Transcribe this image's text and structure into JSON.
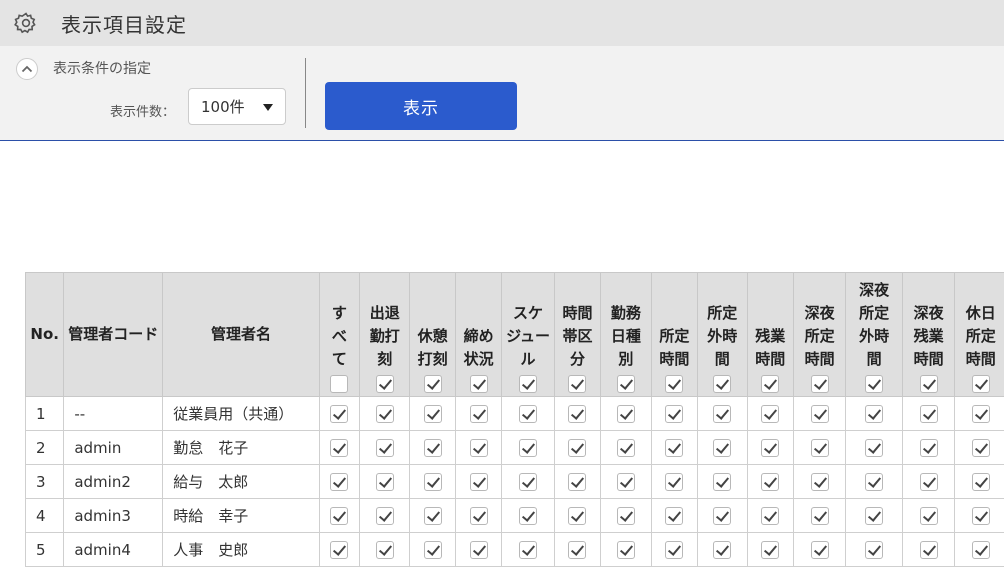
{
  "header": {
    "title": "表示項目設定",
    "icon": "gear-icon"
  },
  "conditions": {
    "title": "表示条件の指定",
    "count_label": "表示件数：",
    "count_value": "100件",
    "show_button": "表示"
  },
  "table": {
    "columns": [
      {
        "label": "No.",
        "type": "text"
      },
      {
        "label": "管理者コード",
        "type": "text"
      },
      {
        "label": "管理者名",
        "type": "text"
      },
      {
        "label": "すべて",
        "lines": [
          "す",
          "べ",
          "て"
        ],
        "checked": false
      },
      {
        "label": "出退勤打刻",
        "lines": [
          "出退",
          "勤打",
          "刻"
        ],
        "checked": true
      },
      {
        "label": "休憩打刻",
        "lines": [
          "休憩",
          "打刻"
        ],
        "checked": true
      },
      {
        "label": "締め状況",
        "lines": [
          "締め",
          "状況"
        ],
        "checked": true
      },
      {
        "label": "スケジュール",
        "lines": [
          "スケ",
          "ジュー",
          "ル"
        ],
        "checked": true
      },
      {
        "label": "時間帯区分",
        "lines": [
          "時間",
          "帯区",
          "分"
        ],
        "checked": true
      },
      {
        "label": "勤務日種別",
        "lines": [
          "勤務",
          "日種",
          "別"
        ],
        "checked": true
      },
      {
        "label": "所定時間",
        "lines": [
          "所定",
          "時間"
        ],
        "checked": true
      },
      {
        "label": "所定外時間",
        "lines": [
          "所定",
          "外時",
          "間"
        ],
        "checked": true
      },
      {
        "label": "残業時間",
        "lines": [
          "残業",
          "時間"
        ],
        "checked": true
      },
      {
        "label": "深夜所定時間",
        "lines": [
          "深夜",
          "所定",
          "時間"
        ],
        "checked": true
      },
      {
        "label": "深夜所定外時間",
        "lines": [
          "深夜",
          "所定",
          "外時",
          "間"
        ],
        "checked": true
      },
      {
        "label": "深夜残業時間",
        "lines": [
          "深夜",
          "残業",
          "時間"
        ],
        "checked": true
      },
      {
        "label": "休日所定時間",
        "lines": [
          "休日",
          "所定",
          "時間"
        ],
        "checked": true
      }
    ],
    "rows": [
      {
        "no": "1",
        "code": "--",
        "name": "従業員用（共通）"
      },
      {
        "no": "2",
        "code": "admin",
        "name": "勤怠　花子"
      },
      {
        "no": "3",
        "code": "admin2",
        "name": "給与　太郎"
      },
      {
        "no": "4",
        "code": "admin3",
        "name": "時給　幸子"
      },
      {
        "no": "5",
        "code": "admin4",
        "name": "人事　史郎"
      }
    ]
  }
}
